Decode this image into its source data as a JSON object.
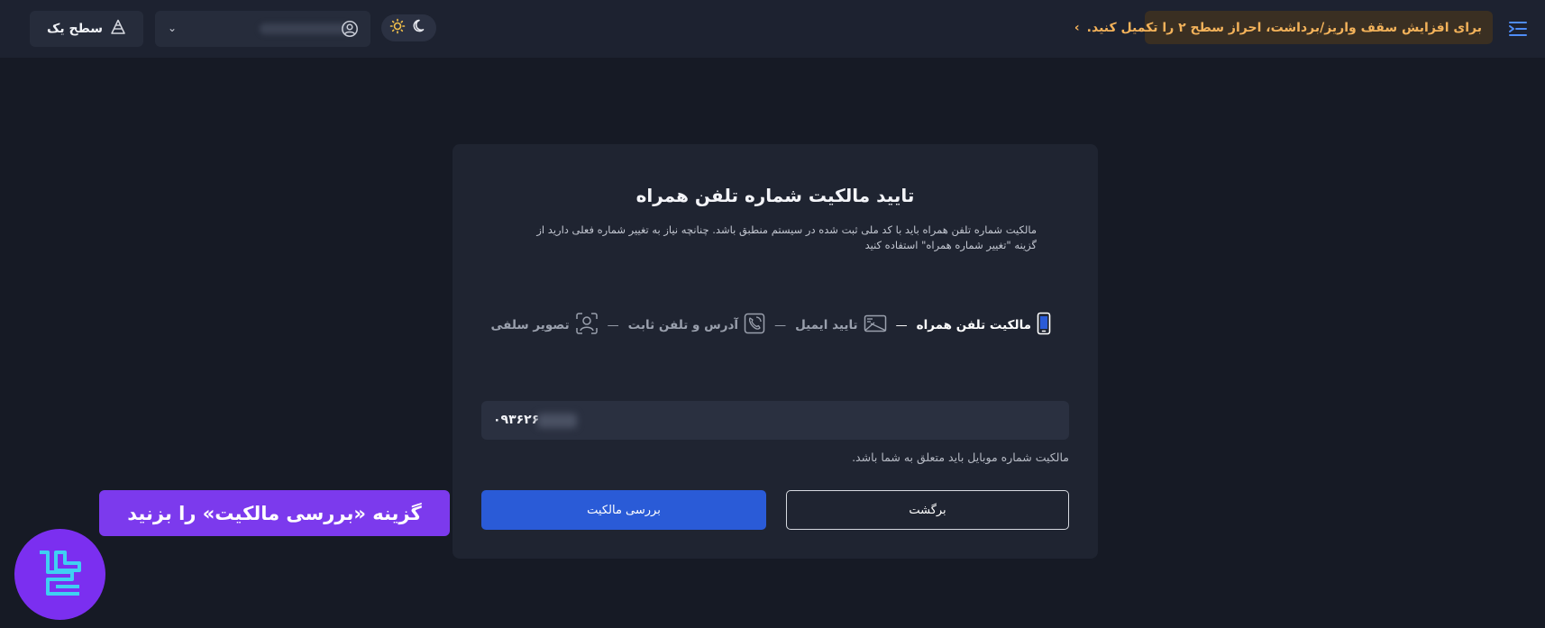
{
  "header": {
    "notice_text": "برای افزایش سقف واریز/برداشت، احراز سطح ۲ را تکمیل کنید.",
    "notice_chevron": "›",
    "level_label": "سطح یک",
    "user_dropdown_chevron": "⌄"
  },
  "card": {
    "title": "تایید مالکیت شماره تلفن همراه",
    "description": "مالکیت شماره تلفن همراه باید با کد ملی ثبت شده در سیستم منطبق باشد. چنانچه نیاز به تغییر شماره فعلی دارید از گزینه \"تغییر شماره همراه\" استفاده کنید",
    "steps": [
      {
        "label": "مالکیت تلفن همراه",
        "icon": "mobile-icon",
        "active": true
      },
      {
        "label": "تایید ایمیل",
        "icon": "email-icon",
        "active": false
      },
      {
        "label": "آدرس و تلفن ثابت",
        "icon": "landline-phone-icon",
        "active": false
      },
      {
        "label": "تصویر سلفی",
        "icon": "selfie-icon",
        "active": false
      }
    ],
    "step_separator": "—",
    "phone_value": "۰۹۳۶۲۶",
    "hint": "مالکیت شماره موبایل باید متعلق به شما باشد.",
    "check_button": "بررسی مالکیت",
    "back_button": "برگشت"
  },
  "overlay": {
    "callout_text": "گزینه «بررسی مالکیت» را بزنید"
  },
  "colors": {
    "background": "#161a25",
    "topbar": "#1d2230",
    "card": "#1f2431",
    "primary": "#2a5bd7",
    "notice_bg": "#3a2f22",
    "notice_text": "#f3b25a",
    "callout": "#7c3aed"
  }
}
